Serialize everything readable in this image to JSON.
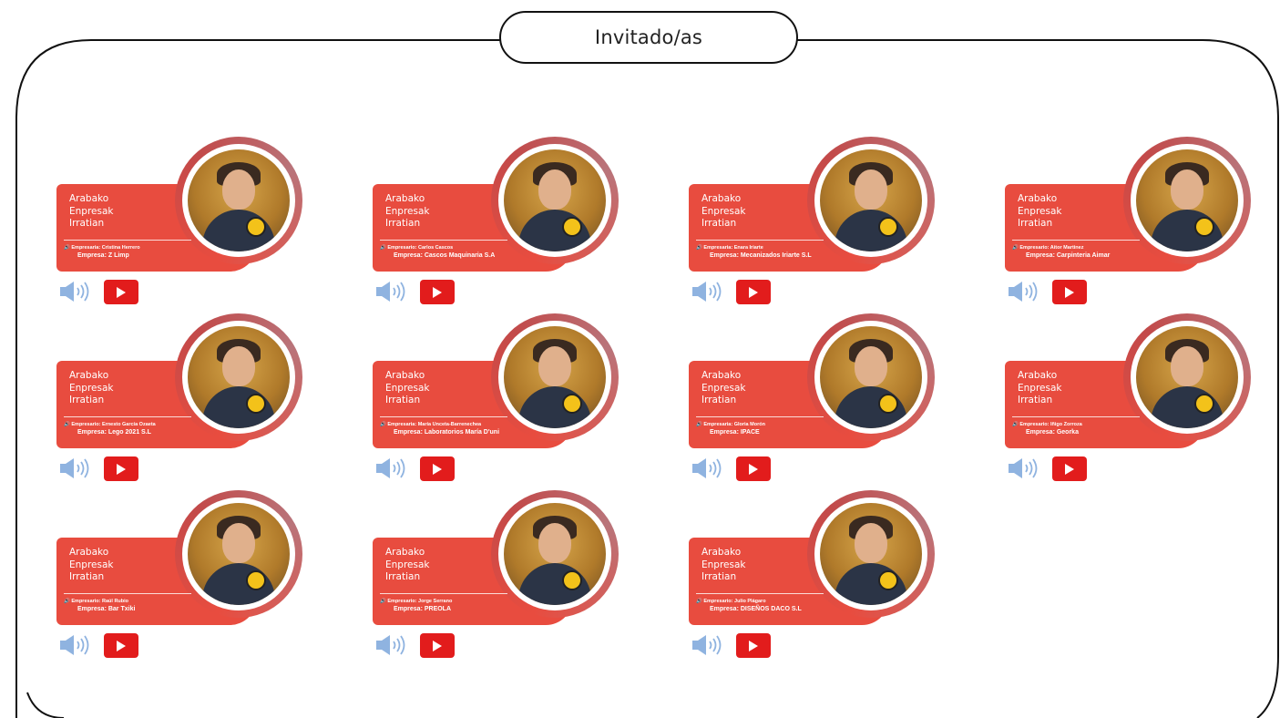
{
  "header": {
    "title": "Invitado/as"
  },
  "colors": {
    "card": "#e84c3f",
    "youtube": "#e21c1c",
    "speaker": "#8fb3e0"
  },
  "guests": [
    {
      "brand": [
        "Arabako",
        "Enpresak",
        "Irratian"
      ],
      "empresario": "Empresaria: Cristina Herrero",
      "empresa": "Empresa: Z Limp"
    },
    {
      "brand": [
        "Arabako",
        "Enpresak",
        "Irratian"
      ],
      "empresario": "Empresario: Carlos Cascos",
      "empresa": "Empresa: Cascos Maquinaria S.A"
    },
    {
      "brand": [
        "Arabako",
        "Enpresak",
        "Irratian"
      ],
      "empresario": "Empresaria: Enara Iriarte",
      "empresa": "Empresa: Mecanizados Iriarte S.L"
    },
    {
      "brand": [
        "Arabako",
        "Enpresak",
        "Irratian"
      ],
      "empresario": "Empresario: Aitor Martinez",
      "empresa": "Empresa: Carpinteria Aimar"
    },
    {
      "brand": [
        "Arabako",
        "Enpresak",
        "Irratian"
      ],
      "empresario": "Empresario: Ernesto García Ozaeta",
      "empresa": "Empresa: Lego 2021 S.L"
    },
    {
      "brand": [
        "Arabako",
        "Enpresak",
        "Irratian"
      ],
      "empresario": "Empresaria: María Unceta-Barrenechea",
      "empresa": "Empresa: Laboratorios María D'uni"
    },
    {
      "brand": [
        "Arabako",
        "Enpresak",
        "Irratian"
      ],
      "empresario": "Empresaria: Gloria Morón",
      "empresa": "Empresa: IPACE"
    },
    {
      "brand": [
        "Arabako",
        "Enpresak",
        "Irratian"
      ],
      "empresario": "Empresario: Iñigo Zorroza",
      "empresa": "Empresa: Georka"
    },
    {
      "brand": [
        "Arabako",
        "Enpresak",
        "Irratian"
      ],
      "empresario": "Empresario: Raúl Rubio",
      "empresa": "Empresa: Bar Txiki"
    },
    {
      "brand": [
        "Arabako",
        "Enpresak",
        "Irratian"
      ],
      "empresario": "Empresario: Jorge Serrano",
      "empresa": "Empresa: PREOLA"
    },
    {
      "brand": [
        "Arabako",
        "Enpresak",
        "Irratian"
      ],
      "empresario": "Empresario: Julio Plágaro",
      "empresa": "Empresa: DISEÑOS DACO S.L"
    }
  ],
  "icons": {
    "audio": "speaker-icon",
    "video": "youtube-play-icon"
  }
}
